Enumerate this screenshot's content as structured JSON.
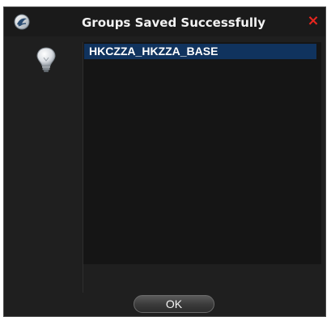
{
  "dialog": {
    "title": "Groups Saved Successfully",
    "close_label": "×",
    "app_icon": "app-logo-icon",
    "message_icon": "lightbulb-icon",
    "accent_close_color": "#e8261f",
    "selection_color": "#10335e"
  },
  "groups": {
    "items": [
      {
        "label": "HKCZZA_HKZZA_BASE",
        "selected": true
      }
    ]
  },
  "buttons": {
    "ok_label": "OK"
  }
}
